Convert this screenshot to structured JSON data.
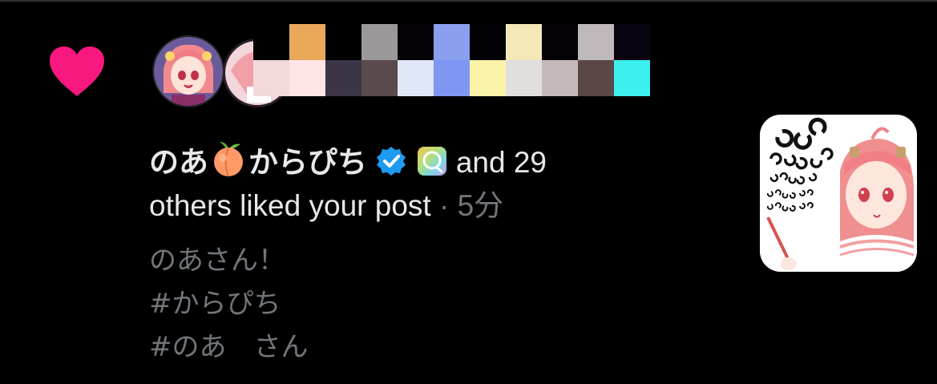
{
  "colors": {
    "background": "#000000",
    "heart": "#f91880",
    "primary_text": "#e7e9ea",
    "secondary_text": "#71767b",
    "verified": "#1d9bf0"
  },
  "icons": [
    "heart-icon",
    "peach-icon",
    "verified-badge-icon",
    "gradient-badge-icon"
  ],
  "notification": {
    "user_name_part1": "のあ",
    "user_name_part2": "からぴち",
    "and_others": " and 29",
    "liked_text": "others liked your post",
    "separator": " · ",
    "time": "5分",
    "post_text_lines": [
      "のあさん！",
      "#からぴち",
      "#のあ　さん"
    ]
  }
}
